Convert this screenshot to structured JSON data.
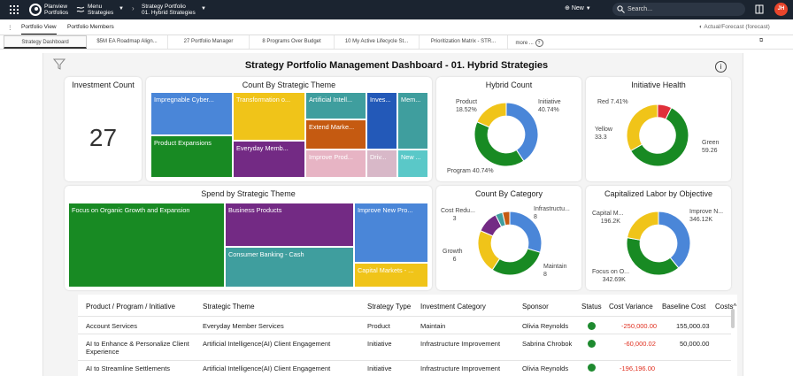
{
  "topbar": {
    "brand_line1": "Planview",
    "brand_line2": "Portfolios",
    "menu_line1": "Menu",
    "menu_line2": "Strategies",
    "bc_line1": "Strategy Portfolio",
    "bc_line2": "01. Hybrid Strategies",
    "new_label": "New",
    "search_placeholder": "Search...",
    "avatar_initials": "JH"
  },
  "nav": {
    "tabs": [
      "Portfolio View",
      "Portfolio Members"
    ],
    "forecast_label": "Actual/Forecast (forecast)"
  },
  "subtabs": [
    "Strategy Dashboard",
    "$5M EA Roadmap Align...",
    "27 Portfolio Manager",
    "8 Programs Over Budget",
    "10 My Active Lifecycle St...",
    "Prioritization Matrix - STR...",
    "more ..."
  ],
  "dashboard": {
    "title": "Strategy Portfolio Management Dashboard - 01. Hybrid Strategies"
  },
  "cards": {
    "investment_count": {
      "title": "Investment Count",
      "value": "27"
    },
    "count_by_theme": {
      "title": "Count By Strategic Theme"
    },
    "hybrid_count": {
      "title": "Hybrid Count"
    },
    "initiative_health": {
      "title": "Initiative Health"
    },
    "spend_by_theme": {
      "title": "Spend by Strategic Theme"
    },
    "count_by_category": {
      "title": "Count By Category"
    },
    "capitalized_labor": {
      "title": "Capitalized Labor by Objective"
    }
  },
  "colors": {
    "blue": "#4a86d8",
    "green": "#188a23",
    "yellow": "#f0c419",
    "purple": "#732a84",
    "teal": "#3f9e9e",
    "orange": "#c55a11",
    "red": "#e0303a",
    "pink": "#e7b4c4",
    "dark_blue": "#2359b8",
    "light_teal": "#5ac8c8",
    "mauve": "#d8b8c8"
  },
  "chart_data": [
    {
      "type": "treemap",
      "title": "Count By Strategic Theme",
      "labels": [
        "Impregnable Cyber...",
        "Product Expansions",
        "Transformation o...",
        "Everyday Memb...",
        "Artificial Intell...",
        "Extend Marke...",
        "Improve Prod...",
        "Inves...",
        "Driv...",
        "Mem...",
        "New ..."
      ]
    },
    {
      "type": "pie",
      "title": "Hybrid Count",
      "slices": [
        {
          "label": "Initiative",
          "percent": "40.74%",
          "value": 40.74,
          "color": "#4a86d8"
        },
        {
          "label": "Program",
          "percent": "40.74%",
          "value": 40.74,
          "color": "#188a23"
        },
        {
          "label": "Product",
          "percent": "18.52%",
          "value": 18.52,
          "color": "#f0c419"
        }
      ]
    },
    {
      "type": "pie",
      "title": "Initiative Health",
      "slices": [
        {
          "label": "Red",
          "percent": "7.41%",
          "value": 7.41,
          "color": "#e0303a"
        },
        {
          "label": "Green",
          "percent": "59.26",
          "value": 59.26,
          "color": "#188a23"
        },
        {
          "label": "Yellow",
          "percent": "33.3",
          "value": 33.33,
          "color": "#f0c419"
        }
      ]
    },
    {
      "type": "treemap",
      "title": "Spend by Strategic Theme",
      "labels": [
        "Focus on Organic Growth and Expansion",
        "Business Products",
        "Consumer Banking - Cash",
        "Improve New Pro...",
        "Capital Markets - ..."
      ]
    },
    {
      "type": "pie",
      "title": "Count By Category",
      "slices": [
        {
          "label": "Infrastructu...",
          "value_label": "8",
          "value": 8,
          "color": "#4a86d8"
        },
        {
          "label": "Maintain",
          "value_label": "8",
          "value": 8,
          "color": "#188a23"
        },
        {
          "label": "Growth",
          "value_label": "6",
          "value": 6,
          "color": "#f0c419"
        },
        {
          "label": "Cost Redu...",
          "value_label": "3",
          "value": 3,
          "color": "#732a84"
        },
        {
          "label": "",
          "value": 1,
          "color": "#3f9e9e"
        },
        {
          "label": "",
          "value": 1,
          "color": "#c55a11"
        }
      ]
    },
    {
      "type": "pie",
      "title": "Capitalized Labor by Objective",
      "slices": [
        {
          "label": "Improve N...",
          "value_label": "346.12K",
          "value": 346.12,
          "color": "#4a86d8"
        },
        {
          "label": "Focus on O...",
          "value_label": "342.69K",
          "value": 342.69,
          "color": "#188a23"
        },
        {
          "label": "Capital M...",
          "value_label": "196.2K",
          "value": 196.2,
          "color": "#f0c419"
        }
      ]
    }
  ],
  "table": {
    "headers": [
      "Product / Program / Initiative",
      "Strategic Theme",
      "Strategy Type",
      "Investment Category",
      "Sponsor",
      "Status",
      "Cost Variance",
      "Baseline Cost",
      "Costs^"
    ],
    "rows": [
      {
        "name": "Account Services",
        "name2": "",
        "theme": "Everyday Member Services",
        "type": "Product",
        "category": "Maintain",
        "sponsor": "Olivia Reynolds",
        "status": "green",
        "variance": "-250,000.00",
        "baseline": "155,000.03"
      },
      {
        "name": "AI to Enhance & Personalize Client",
        "name2": "Experience",
        "theme": "Artificial Intelligence(AI) Client Engagement",
        "type": "Initiative",
        "category": "Infrastructure Improvement",
        "sponsor": "Sabrina Chrobok",
        "status": "green",
        "variance": "-60,000.02",
        "baseline": "50,000.00"
      },
      {
        "name": "AI to Streamline Settlements",
        "name2": "",
        "theme": "Artificial Intelligence(AI) Client Engagement",
        "type": "Initiative",
        "category": "Infrastructure Improvement",
        "sponsor": "Olivia Reynolds",
        "status": "green",
        "variance": "-196,196.00",
        "baseline": ""
      }
    ]
  }
}
